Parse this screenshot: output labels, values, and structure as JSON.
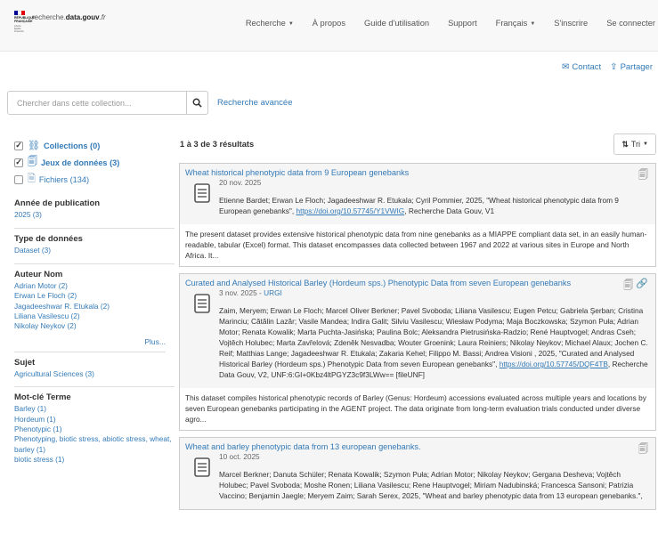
{
  "brand": {
    "republic": "RÉPUBLIQUE FRANÇAISE",
    "motto": "Liberté Égalité Fraternité",
    "site_prefix": "recherche.",
    "site_bold": "data.gouv",
    "site_suffix": ".fr",
    "flag_colors": [
      "#000091",
      "#ffffff",
      "#e1000f"
    ]
  },
  "nav": {
    "items": [
      "Recherche",
      "À propos",
      "Guide d'utilisation",
      "Support",
      "Français",
      "S'inscrire",
      "Se connecter"
    ]
  },
  "actions": {
    "contact": "Contact",
    "share": "Partager"
  },
  "search": {
    "placeholder": "Chercher dans cette collection...",
    "value": "",
    "advanced": "Recherche avancée"
  },
  "sidebar": {
    "types": [
      {
        "label": "Collections (0)",
        "checked": true,
        "icon": "collection-icon"
      },
      {
        "label": "Jeux de données (3)",
        "checked": true,
        "icon": "dataset-icon"
      },
      {
        "label": "Fichiers (134)",
        "checked": false,
        "icon": "file-icon"
      }
    ],
    "year": {
      "title": "Année de publication",
      "items": [
        "2025 (3)"
      ]
    },
    "data_type": {
      "title": "Type de données",
      "items": [
        "Dataset (3)"
      ]
    },
    "author": {
      "title": "Auteur Nom",
      "items": [
        "Adrian Motor (2)",
        "Erwan Le Floch (2)",
        "Jagadeeshwar R. Etukala (2)",
        "Liliana Vasilescu (2)",
        "Nikolay Neykov (2)"
      ],
      "more": "Plus..."
    },
    "subject": {
      "title": "Sujet",
      "items": [
        "Agricultural Sciences (3)"
      ]
    },
    "keyword": {
      "title": "Mot-clé Terme",
      "items": [
        "Barley (1)",
        "Hordeum (1)",
        "Phenotypic (1)",
        "Phenotyping, biotic stress, abiotic stress, wheat, barley (1)",
        "biotic stress (1)"
      ]
    }
  },
  "results": {
    "count": "1 à 3 de 3 résultats",
    "sort": "Tri",
    "items": [
      {
        "title": "Wheat historical phenotypic data from 9 European genebanks",
        "date": "20 nov. 2025",
        "source": "",
        "citation_text": "Etienne Bardet; Erwan Le Floch; Jagadeeshwar R. Etukala; Cyril Pommier, 2025, \"Wheat historical phenotypic data from 9 European genebanks\", ",
        "doi": "https://doi.org/10.57745/Y1VWIG",
        "citation_tail": ", Recherche Data Gouv, V1",
        "description": "The present dataset provides extensive historical phenotypic data from nine genebanks as a MIAPPE compliant data set, in an easily human-readable, tabular (Excel) format. This dataset encompasses data collected between 1967 and 2022 at various sites in Europe and North Africa. It..."
      },
      {
        "title": "Curated and Analysed Historical Barley (Hordeum sps.) Phenotypic Data from seven European genebanks",
        "date": "3 nov. 2025 - ",
        "source": "URGI",
        "citation_text": "Zaim, Meryem; Erwan Le Floch; Marcel Oliver Berkner; Pavel Svoboda; Liliana Vasilescu; Eugen Petcu; Gabriela Şerban; Cristina Marinciu; Cătălin Lazăr; Vasile Mandea; Indira Galit; Silviu Vasilescu; Wiesław Podyma; Maja Boczkowska; Szymon Puła; Adrian Motor; Renata Kowalik; Marta Puchta-Jasińska; Paulina Bolc; Aleksandra Pietrusińska-Radzio; René Hauptvogel; Andras Cseh; Vojtěch Holubec; Marta Zavřelová; Zdeněk Nesvadba; Wouter Groenink; Laura Reiniers; Nikolay Neykov; Michael Alaux; Jochen C. Reif; Matthias Lange; Jagadeeshwar R. Etukala; Zakaria Kehel; Filippo M. Bassi; Andrea Visioni , 2025, \"Curated and Analysed Historical Barley (Hordeum sps.) Phenotypic Data from seven European genebanks\", ",
        "doi": "https://doi.org/10.57745/DQF4TB",
        "citation_tail": ", Recherche Data Gouv, V2, UNF:6:GI+0Kbz4ltPGYZ3c9f3LWw== [fileUNF]",
        "description": "This dataset compiles historical phenotypic records of Barley (Genus: Hordeum) accessions evaluated across multiple years and locations by seven European genebanks participating in the AGENT project. The data originate from long-term evaluation trials conducted under diverse agro..."
      },
      {
        "title": "Wheat and barley phenotypic data from 13 european genebanks.",
        "date": "10 oct. 2025",
        "source": "",
        "citation_text": "Marcel Berkner; Danuta Schüler; Renata Kowalik; Szymon Puła; Adrian Motor; Nikolay Neykov; Gergana Desheva; Vojtěch Holubec; Pavel Svoboda; Moshe Ronen; Liliana Vasilescu; Rene Hauptvogel; Miriam Nadubinská; Francesca Sansoni; Patrizia Vaccino; Benjamin Jaegle; Meryem Zaim; Sarah Serex, 2025, \"Wheat and barley phenotypic data from 13 european genebanks.\",",
        "doi": "",
        "citation_tail": "",
        "description": ""
      }
    ]
  }
}
